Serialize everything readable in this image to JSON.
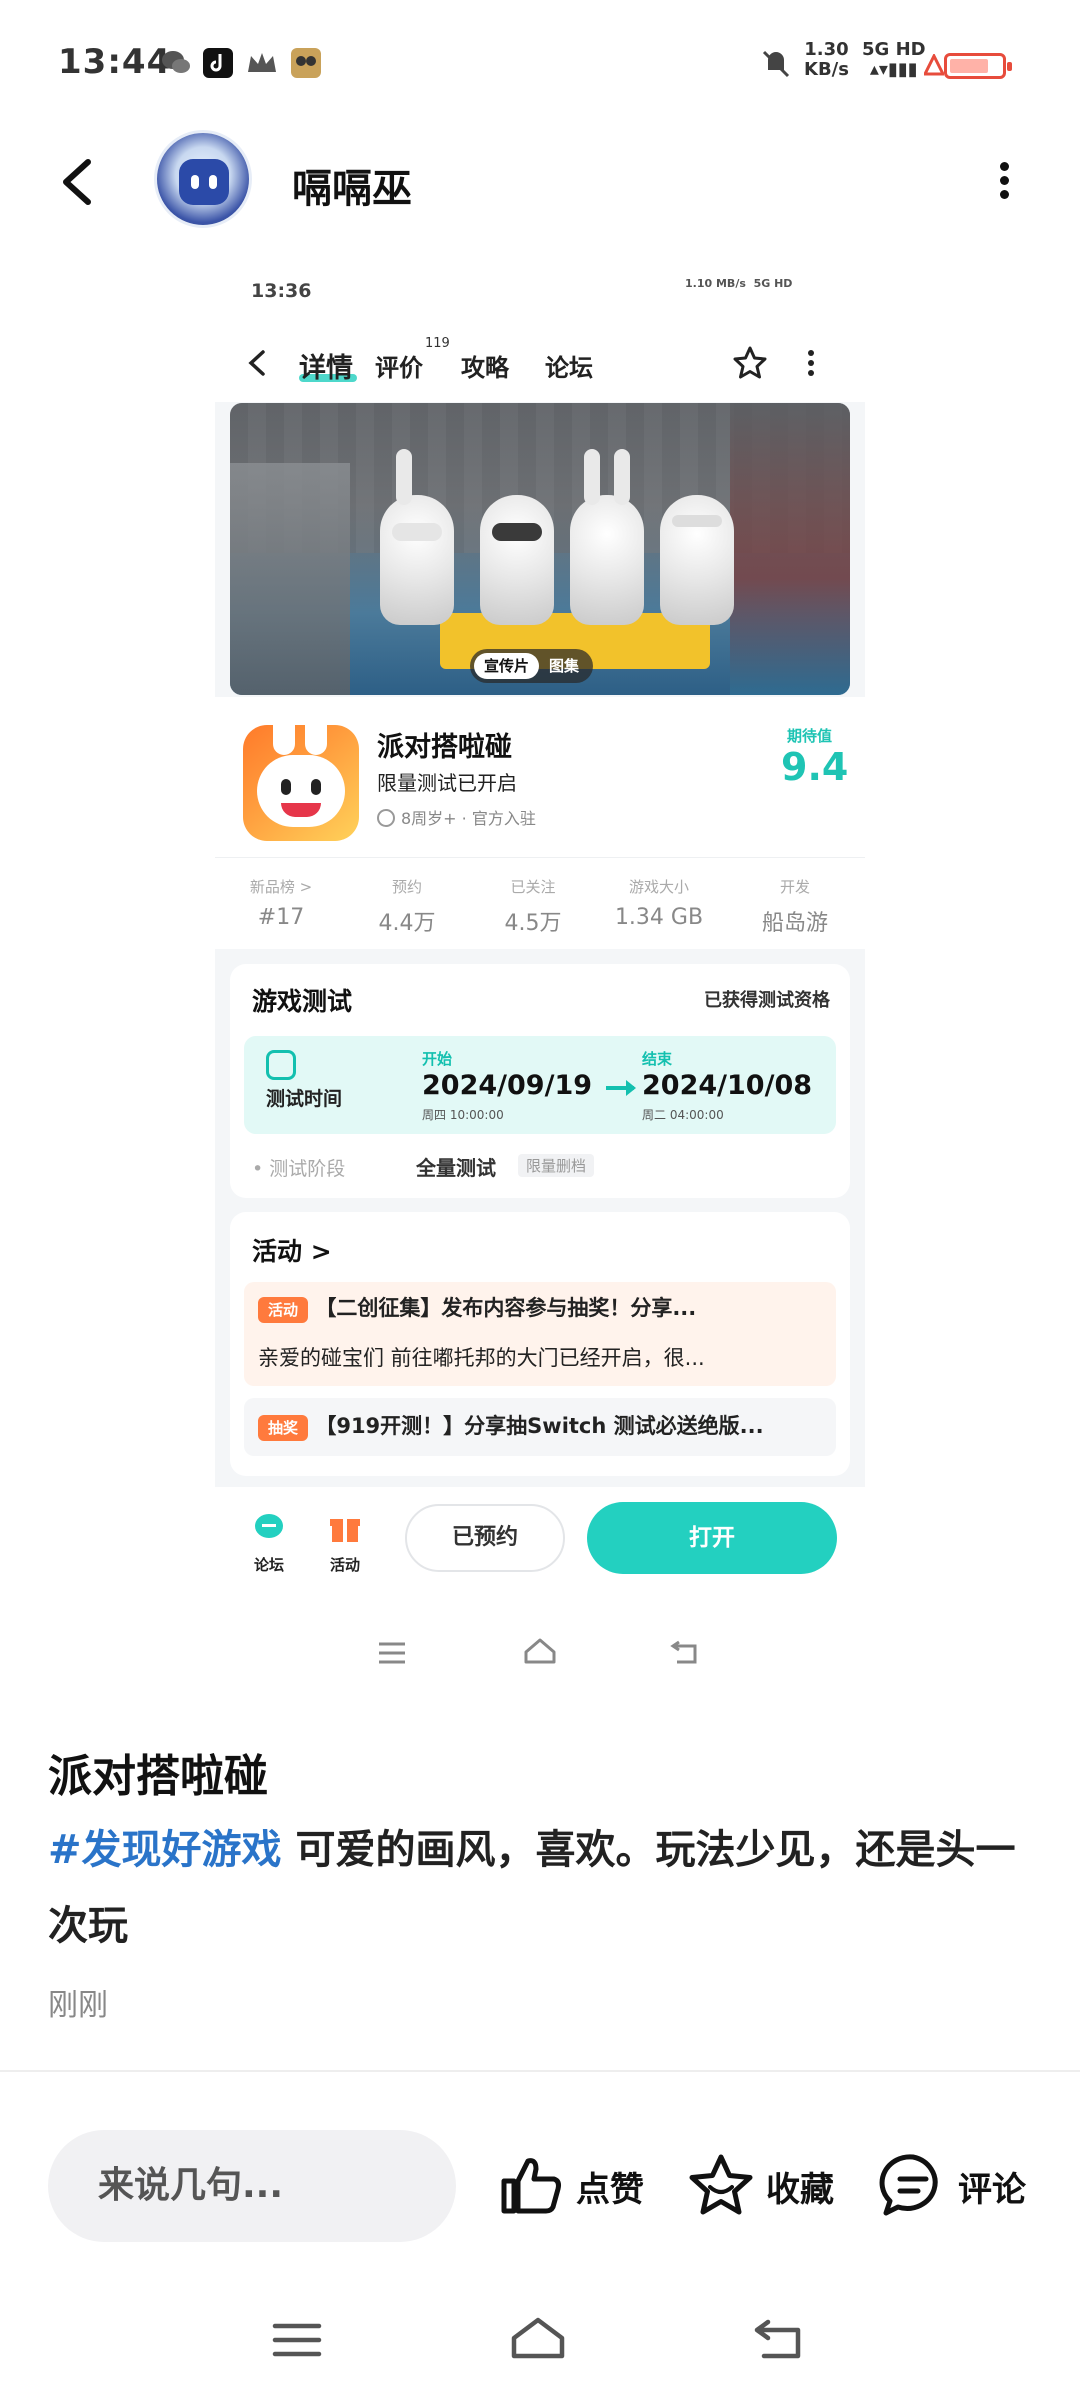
{
  "status_bar": {
    "time": "13:44",
    "net_speed": "1.30",
    "net_unit": "KB/s",
    "signal": "5G HD",
    "battery_level": 0.75
  },
  "header": {
    "username": "嗝嗝巫"
  },
  "embedded": {
    "status_time": "13:36",
    "status_speed": "1.10",
    "status_unit": "MB/s",
    "status_signal": "5G HD",
    "tabs": [
      {
        "label": "详情"
      },
      {
        "label": "评价"
      },
      {
        "label": "攻略"
      },
      {
        "label": "论坛"
      }
    ],
    "review_count": "119",
    "banner_tabs": [
      "宣传片",
      "图集"
    ],
    "app": {
      "name": "派对搭啦碰",
      "subtitle": "限量测试已开启",
      "meta": "8周岁+ · 官方入驻",
      "score_label": "期待值",
      "score": "9.4"
    },
    "stats": [
      {
        "label": "新品榜 >",
        "value": "#17"
      },
      {
        "label": "预约",
        "value": "4.4万"
      },
      {
        "label": "已关注",
        "value": "4.5万"
      },
      {
        "label": "游戏大小",
        "value": "1.34 GB"
      },
      {
        "label": "开发",
        "value": "船岛游"
      }
    ],
    "test_card": {
      "title": "游戏测试",
      "status": "已获得测试资格",
      "time_label": "测试时间",
      "start_tag": "开始",
      "start_date": "2024/09/19",
      "start_time": "周四  10:00:00",
      "end_tag": "结束",
      "end_date": "2024/10/08",
      "end_time": "周二  04:00:00",
      "stage_label": "测试阶段",
      "stage_value": "全量测试",
      "stage_tag": "限量删档"
    },
    "activity_card": {
      "title": "活动 >",
      "item1_badge": "活动",
      "item1_title": "【二创征集】发布内容参与抽奖！分享...",
      "item1_desc": "亲爱的碰宝们 前往嘟托邦的大门已经开启，很...",
      "item2_badge": "抽奖",
      "item2_title": "【919开测！】分享抽Switch 测试必送绝版..."
    },
    "bottom_bar": {
      "forum": "论坛",
      "activity": "活动",
      "reserved": "已预约",
      "open": "打开"
    }
  },
  "post": {
    "title": "派对搭啦碰",
    "hashtag": "#发现好游戏",
    "body": " 可爱的画风，喜欢。玩法少见，还是头一次玩",
    "time": "刚刚"
  },
  "actions": {
    "comment_placeholder": "来说几句...",
    "like": "点赞",
    "favorite": "收藏",
    "comment": "评论"
  },
  "colors": {
    "accent_teal": "#23d0c0",
    "hashtag_blue": "#2a74c9",
    "activity_orange": "#ff7a3d"
  }
}
